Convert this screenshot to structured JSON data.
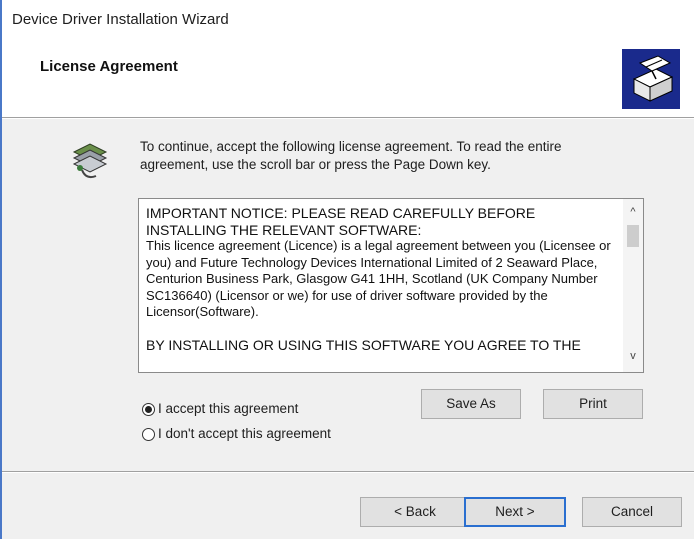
{
  "window": {
    "title": "Device Driver Installation Wizard"
  },
  "header": {
    "title": "License Agreement",
    "logo_icon": "setup-box-icon"
  },
  "instruction": {
    "icon": "installer-icon",
    "text": "To continue, accept the following license agreement. To read the entire agreement, use the scroll bar or press the Page Down key."
  },
  "license": {
    "heading": "IMPORTANT NOTICE: PLEASE READ CAREFULLY BEFORE INSTALLING THE RELEVANT SOFTWARE:",
    "body": "This licence agreement (Licence) is a legal agreement between you (Licensee or you) and Future Technology Devices International Limited of 2 Seaward Place, Centurion Business Park, Glasgow G41 1HH, Scotland (UK Company Number SC136640) (Licensor or we) for use of driver software provided by the Licensor(Software).",
    "tail": "BY INSTALLING OR USING THIS SOFTWARE YOU AGREE TO THE"
  },
  "scrollbar": {
    "up_glyph": "^",
    "down_glyph": "v"
  },
  "options": {
    "accept": "I accept this agreement",
    "decline": "I don't accept this agreement",
    "selected": "accept"
  },
  "buttons": {
    "save_as": "Save As",
    "print": "Print",
    "back": "< Back",
    "next": "Next >",
    "cancel": "Cancel"
  },
  "colors": {
    "accent": "#2a6fd0",
    "logo_bg": "#1a2a8c",
    "window_bg": "#f0f0f0"
  }
}
